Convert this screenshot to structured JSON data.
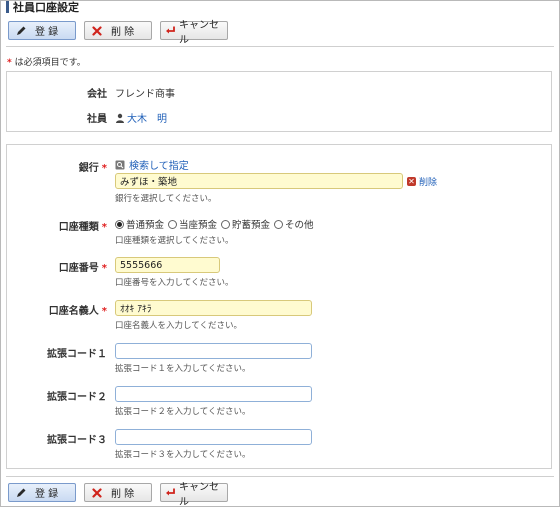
{
  "page": {
    "title": "社員口座設定"
  },
  "toolbar": {
    "register_label": "登 録",
    "delete_label": "削 除",
    "cancel_label": "キャンセル"
  },
  "required_note": "は必須項目です。",
  "required_mark": "*",
  "info": {
    "company_label": "会社",
    "company_value": "フレンド商事",
    "employee_label": "社員",
    "employee_value": "大木　明"
  },
  "form": {
    "bank": {
      "label": "銀行",
      "search_link": "検索して指定",
      "value": "みずほ・築地",
      "delete_link": "削除",
      "hint": "銀行を選択してください。"
    },
    "account_type": {
      "label": "口座種類",
      "options": [
        "普通預金",
        "当座預金",
        "貯蓄預金",
        "その他"
      ],
      "selected": "普通預金",
      "hint": "口座種類を選択してください。"
    },
    "account_number": {
      "label": "口座番号",
      "value": "5555666",
      "hint": "口座番号を入力してください。"
    },
    "account_holder": {
      "label": "口座名義人",
      "value": "ｵｵｷ ｱｷﾗ",
      "hint": "口座名義人を入力してください。"
    },
    "ext_code_1": {
      "label": "拡張コード１",
      "value": "",
      "hint": "拡張コード１を入力してください。"
    },
    "ext_code_2": {
      "label": "拡張コード２",
      "value": "",
      "hint": "拡張コード２を入力してください。"
    },
    "ext_code_3": {
      "label": "拡張コード３",
      "value": "",
      "hint": "拡張コード３を入力してください。"
    }
  },
  "colors": {
    "required_star": "#e02020",
    "link": "#1f5fb8",
    "required_input_bg": "#fffbd0"
  }
}
